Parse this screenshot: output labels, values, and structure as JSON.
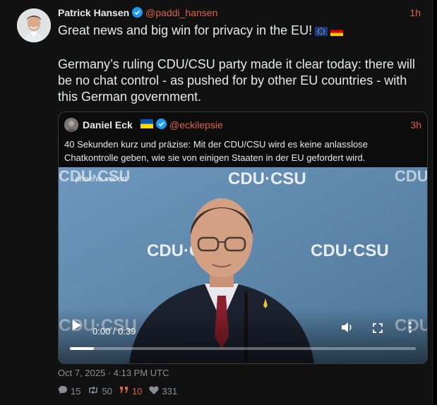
{
  "tweet": {
    "name": "Patrick Hansen",
    "handle": "@paddi_hansen",
    "time": "1h",
    "line1": "Great news and big win for privacy in the EU!",
    "body": "Germany’s ruling CDU/CSU party made it clear today: there will be no chat control - as pushed for by other EU countries - with this German government.",
    "date": "Oct 7, 2025 · 4:13 PM UTC",
    "stats": {
      "replies": "15",
      "retweets": "50",
      "quotes": "10",
      "likes": "331"
    }
  },
  "quote": {
    "name": "Daniel Eck",
    "handle": "@eckilepsie",
    "time": "3h",
    "text": "40 Sekunden kurz und präzise: Mit der CDU/CSU wird es keine anlasslose Chatkontrolle geben, wie sie von einigen Staaten in der EU gefordert wird."
  },
  "video": {
    "time": "0:00 / 0:39",
    "progress": 0.07,
    "logo_text": "CDU·CSU",
    "watermark": "phoenix vor ort"
  },
  "colors": {
    "accent": "#e0624a",
    "verified": "#1d9bf0"
  }
}
